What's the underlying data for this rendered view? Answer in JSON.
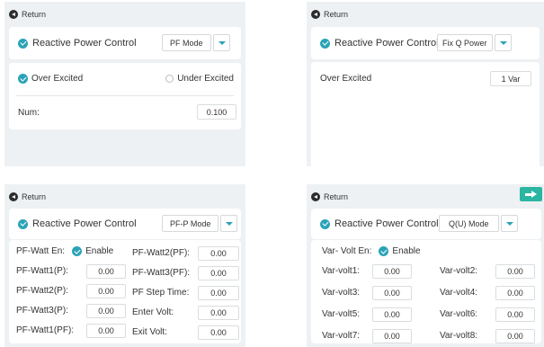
{
  "return_label": "Return",
  "rpc_label": "Reactive Power Control",
  "panel1": {
    "mode": "PF Mode",
    "over_excited": "Over Excited",
    "under_excited": "Under Excited",
    "num_label": "Num:",
    "num_value": "0.100"
  },
  "panel2": {
    "mode": "Fix Q Power",
    "over_excited": "Over Excited",
    "var_value": "1 Var"
  },
  "panel3": {
    "mode": "PF-P Mode",
    "enable_label": "PF-Watt En:",
    "enable_value": "Enable",
    "left": [
      {
        "label": "PF-Watt1(P):",
        "value": "0.00"
      },
      {
        "label": "PF-Watt2(P):",
        "value": "0.00"
      },
      {
        "label": "PF-Watt3(P):",
        "value": "0.00"
      },
      {
        "label": "PF-Watt1(PF):",
        "value": "0.00"
      }
    ],
    "right": [
      {
        "label": "PF-Watt2(PF):",
        "value": "0.00"
      },
      {
        "label": "PF-Watt3(PF):",
        "value": "0.00"
      },
      {
        "label": "PF Step Time:",
        "value": "0.00"
      },
      {
        "label": "Enter Volt:",
        "value": "0.00"
      },
      {
        "label": "Exit Volt:",
        "value": "0.00"
      }
    ]
  },
  "panel4": {
    "mode": "Q(U) Mode",
    "enable_label": "Var- Volt En:",
    "enable_value": "Enable",
    "left": [
      {
        "label": "Var-volt1:",
        "value": "0.00"
      },
      {
        "label": "Var-volt3:",
        "value": "0.00"
      },
      {
        "label": "Var-volt5:",
        "value": "0.00"
      },
      {
        "label": "Var-volt7:",
        "value": "0.00"
      }
    ],
    "right": [
      {
        "label": "Var-volt2:",
        "value": "0.00"
      },
      {
        "label": "Var-volt4:",
        "value": "0.00"
      },
      {
        "label": "Var-volt6:",
        "value": "0.00"
      },
      {
        "label": "Var-volt8:",
        "value": "0.00"
      }
    ]
  },
  "colors": {
    "accent": "#2ba3b7",
    "next_button": "#2bb5a3",
    "panel_bg": "#eef1f3"
  },
  "icons": [
    "return-icon",
    "check-icon",
    "radio-icon",
    "chevron-down-icon",
    "arrow-right-icon"
  ]
}
